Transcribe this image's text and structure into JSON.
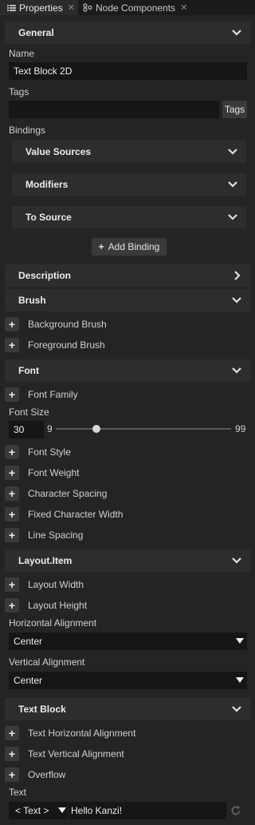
{
  "tabs": [
    {
      "label": "Properties",
      "active": true
    },
    {
      "label": "Node Components",
      "active": false
    }
  ],
  "general": {
    "title": "General",
    "name_label": "Name",
    "name_value": "Text Block 2D",
    "tags_label": "Tags",
    "tags_button": "Tags",
    "bindings_label": "Bindings",
    "binding_groups": [
      "Value Sources",
      "Modifiers",
      "To Source"
    ],
    "add_binding": "Add Binding"
  },
  "description": {
    "title": "Description"
  },
  "brush": {
    "title": "Brush",
    "items": [
      "Background Brush",
      "Foreground Brush"
    ]
  },
  "font": {
    "title": "Font",
    "font_family": "Font Family",
    "font_size_label": "Font Size",
    "font_size_value": "30",
    "slider_min": "9",
    "slider_max": "99",
    "slider_fraction": 0.233,
    "items": [
      "Font Style",
      "Font Weight",
      "Character Spacing",
      "Fixed Character Width",
      "Line Spacing"
    ]
  },
  "layout_item": {
    "title": "Layout.Item",
    "items": [
      "Layout Width",
      "Layout Height"
    ],
    "h_align_label": "Horizontal Alignment",
    "h_align_value": "Center",
    "v_align_label": "Vertical Alignment",
    "v_align_value": "Center"
  },
  "text_block": {
    "title": "Text Block",
    "items": [
      "Text Horizontal Alignment",
      "Text Vertical Alignment",
      "Overflow"
    ],
    "text_label": "Text",
    "text_type": "< Text >",
    "text_value": "Hello Kanzi!"
  },
  "colors": {
    "background": "#242424",
    "section": "#2d2d2d",
    "field": "#161616",
    "button": "#3a3a3a"
  }
}
